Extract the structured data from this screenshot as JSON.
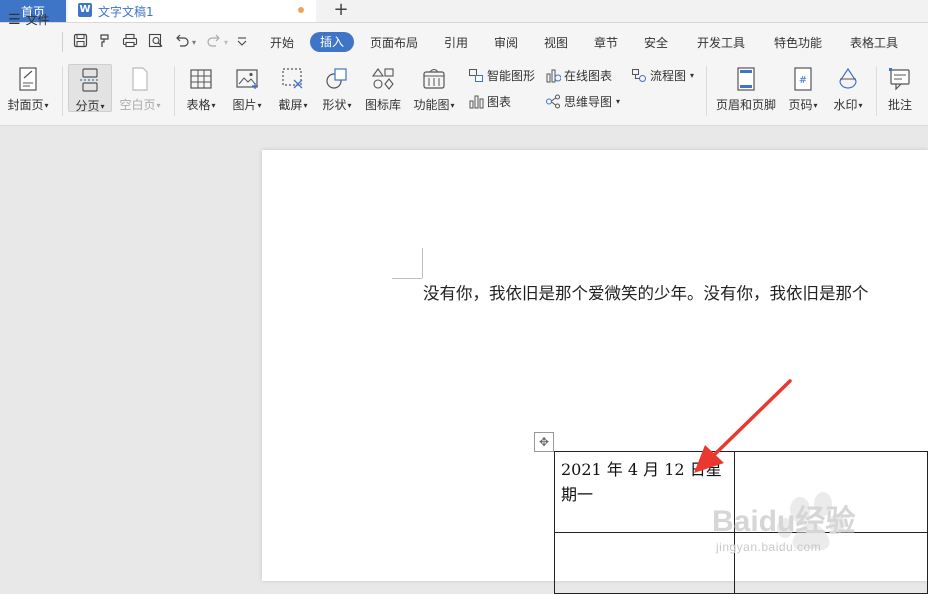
{
  "tabs": {
    "home": "首页",
    "document": "文字文稿1",
    "new_tab": "+"
  },
  "menu": {
    "file": "文件",
    "tabs": [
      "开始",
      "插入",
      "页面布局",
      "引用",
      "审阅",
      "视图",
      "章节",
      "安全",
      "开发工具",
      "特色功能",
      "表格工具"
    ],
    "active": "插入"
  },
  "ribbon": {
    "cover": "封面页",
    "pagebreak": "分页",
    "blankpage": "空白页",
    "table": "表格",
    "picture": "图片",
    "screenshot": "截屏",
    "shape": "形状",
    "iconlib": "图标库",
    "funcchart": "功能图",
    "smartart": "智能图形",
    "chart": "图表",
    "onlinechart": "在线图表",
    "mindmap": "思维导图",
    "flowchart": "流程图",
    "headerfooter": "页眉和页脚",
    "pagenum": "页码",
    "watermark": "水印",
    "comment": "批注"
  },
  "document": {
    "paragraph": "没有你，我依旧是那个爱微笑的少年。没有你，我依旧是那个",
    "cell_text": "2021 年 4 月 12 日星期一"
  },
  "watermark": {
    "brand": "Baidu经验",
    "url": "jingyan.baidu.com"
  },
  "colors": {
    "accent": "#3f75c7",
    "arrow": "#e8382f"
  }
}
